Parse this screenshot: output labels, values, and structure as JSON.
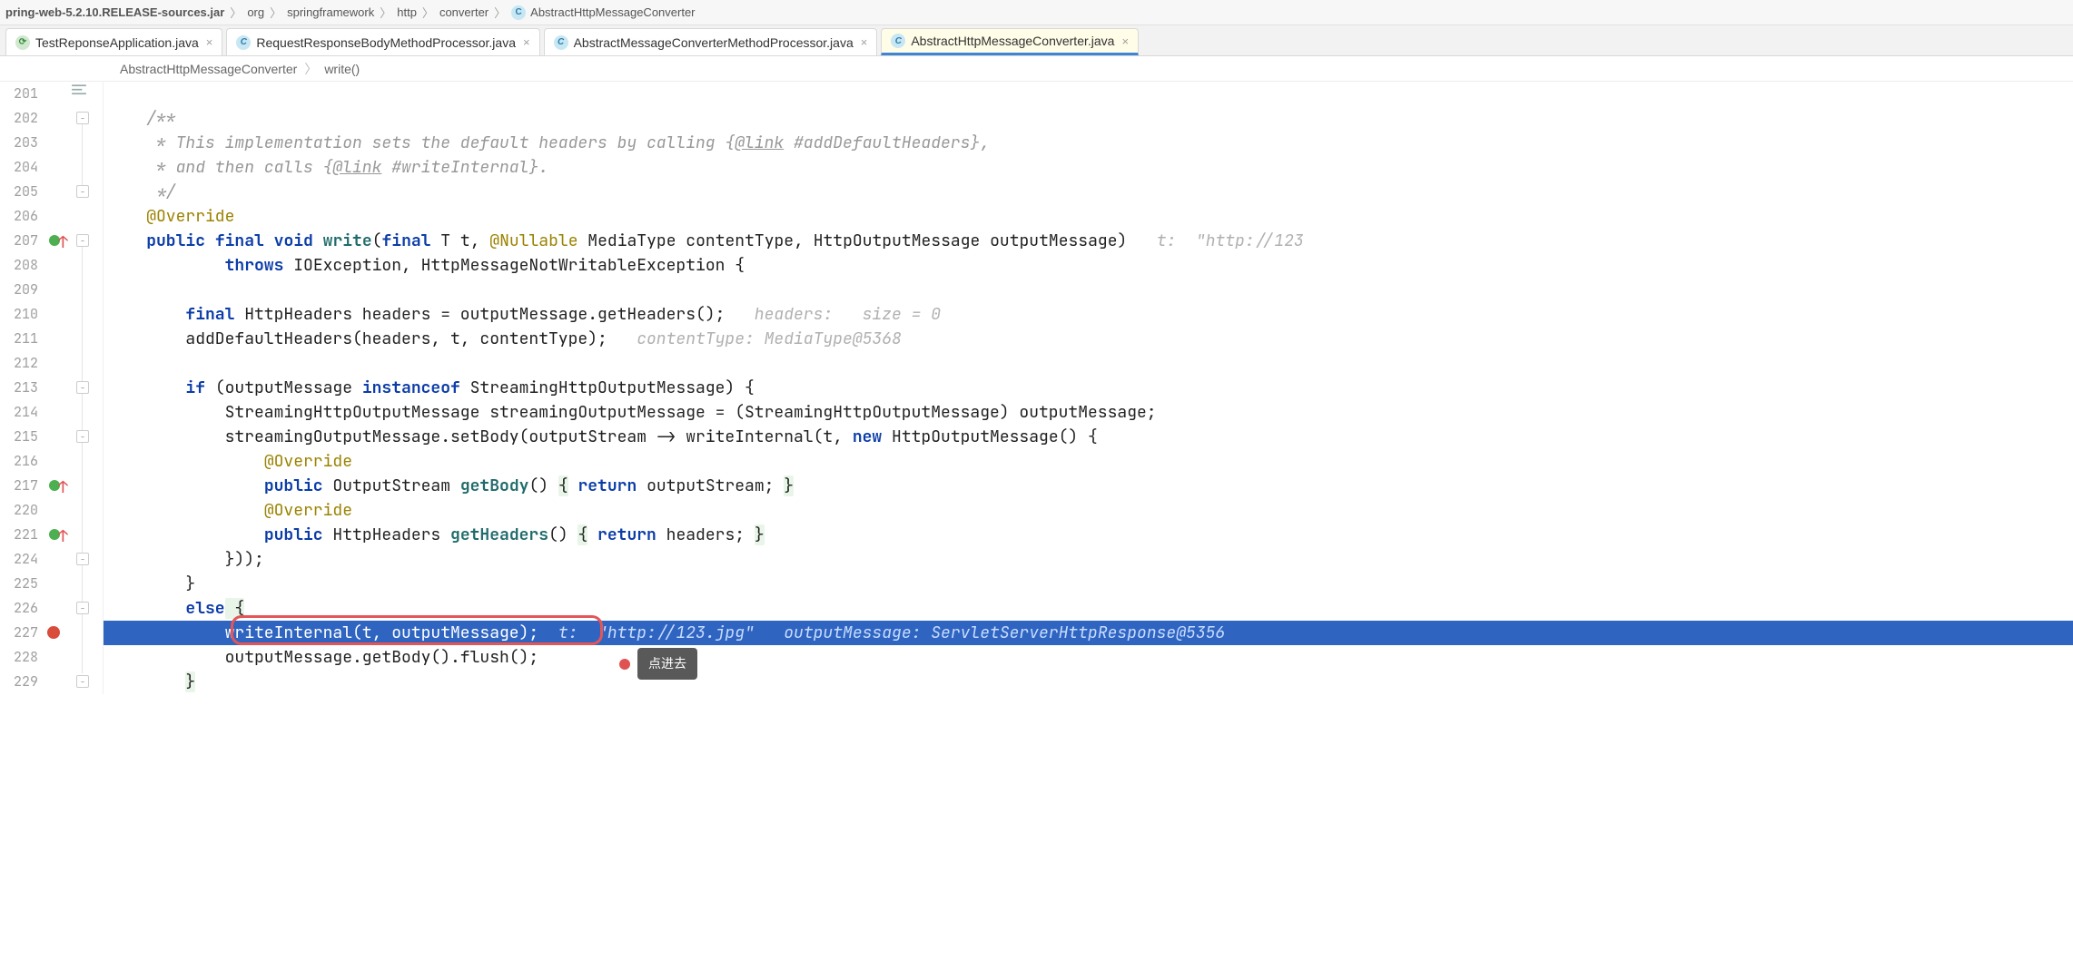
{
  "breadcrumb": {
    "items": [
      "pring-web-5.2.10.RELEASE-sources.jar",
      "org",
      "springframework",
      "http",
      "converter",
      "AbstractHttpMessageConverter"
    ]
  },
  "tabs": [
    {
      "label": "TestReponseApplication.java",
      "icon": "j"
    },
    {
      "label": "RequestResponseBodyMethodProcessor.java",
      "icon": "c"
    },
    {
      "label": "AbstractMessageConverterMethodProcessor.java",
      "icon": "c"
    },
    {
      "label": "AbstractHttpMessageConverter.java",
      "icon": "c",
      "active": true
    }
  ],
  "breadcrumb2": {
    "class": "AbstractHttpMessageConverter",
    "method": "write()"
  },
  "line_numbers": [
    "201",
    "202",
    "203",
    "204",
    "205",
    "206",
    "207",
    "208",
    "209",
    "210",
    "211",
    "212",
    "213",
    "214",
    "215",
    "216",
    "217",
    "220",
    "221",
    "224",
    "225",
    "226",
    "227",
    "228",
    "229"
  ],
  "code": {
    "l202": "/**",
    "l203_a": " * This implementation sets the default headers by calling {",
    "l203_link": "@link",
    "l203_b": " #addDefaultHeaders},",
    "l204_a": " * and then calls {",
    "l204_link": "@link",
    "l204_b": " #writeInternal}.",
    "l205": " */",
    "l206": "@Override",
    "l207_public": "public",
    "l207_final": "final",
    "l207_void": "void",
    "l207_write": "write",
    "l207_open": "(",
    "l207_final2": "final",
    "l207_T": "T",
    "l207_t": " t, ",
    "l207_null": "@Nullable",
    "l207_mt": " MediaType contentType, HttpOutputMessage outputMessage)",
    "l207_hint": "   t:  \"http://123",
    "l208_throws": "throws",
    "l208_rest": " IOException, HttpMessageNotWritableException {",
    "l210_final": "final",
    "l210_rest": " HttpHeaders headers = outputMessage.getHeaders();",
    "l210_hint": "   headers:   size = 0",
    "l211_call": "addDefaultHeaders(headers, t, contentType);",
    "l211_hint": "   contentType: MediaType@5368",
    "l213_if": "if",
    "l213_rest": " (outputMessage ",
    "l213_inst": "instanceof",
    "l213_rest2": " StreamingHttpOutputMessage) {",
    "l214": "StreamingHttpOutputMessage streamingOutputMessage = (StreamingHttpOutputMessage) outputMessage;",
    "l215_a": "streamingOutputMessage.setBody(outputStream -> writeInternal(t, ",
    "l215_new": "new",
    "l215_b": " HttpOutputMessage() {",
    "l216": "@Override",
    "l217_pub": "public",
    "l217_a": " OutputStream ",
    "l217_m": "getBody",
    "l217_b": "() ",
    "l217_ob": "{",
    "l217_ret": " return ",
    "l217_c": "outputStream; ",
    "l217_cb": "}",
    "l220": "@Override",
    "l221_pub": "public",
    "l221_a": " HttpHeaders ",
    "l221_m": "getHeaders",
    "l221_b": "() ",
    "l221_ob": "{",
    "l221_ret": " return ",
    "l221_c": "headers; ",
    "l221_cb": "}",
    "l224": "}));",
    "l225": "}",
    "l226_else": "else",
    "l226_brace": " {",
    "l227_call": "writeInternal(t, outputMessage);",
    "l227_hint": "  t:  \"http://123.jpg\"   outputMessage: ServletServerHttpResponse@5356",
    "l228": "outputMessage.getBody().flush();",
    "l229": "}"
  },
  "tooltip": "点进去"
}
